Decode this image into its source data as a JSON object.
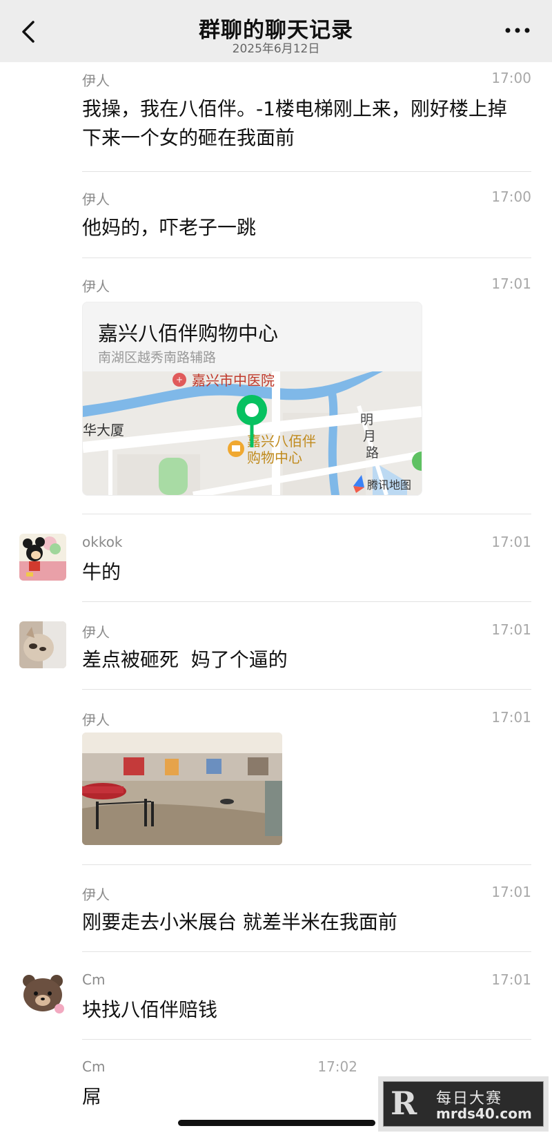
{
  "header": {
    "title": "群聊的聊天记录",
    "subtitle": "2025年6月12日"
  },
  "messages": [
    {
      "name": "伊人",
      "time": "17:00",
      "text": "我操，我在八佰伴。-1楼电梯刚上来，刚好楼上掉下来一个女的砸在我面前"
    },
    {
      "name": "伊人",
      "time": "17:00",
      "text": "他妈的，吓老子一跳"
    },
    {
      "name": "伊人",
      "time": "17:01",
      "location": {
        "title": "嘉兴八佰伴购物中心",
        "address": "南湖区越秀南路辅路",
        "map_labels": {
          "hospital": "嘉兴市中医院",
          "building": "华大厦",
          "poi_line1": "嘉兴八佰伴",
          "poi_line2": "购物中心",
          "road_1": "明",
          "road_2": "月",
          "road_3": "路",
          "provider": "腾讯地图"
        }
      }
    },
    {
      "name": "okkok",
      "time": "17:01",
      "text": "牛的",
      "avatar": "mickey-avatar"
    },
    {
      "name": "伊人",
      "time": "17:01",
      "text": "差点被砸死  妈了个逼的",
      "avatar": "cat-avatar"
    },
    {
      "name": "伊人",
      "time": "17:01",
      "image": "mall-interior-photo"
    },
    {
      "name": "伊人",
      "time": "17:01",
      "text": "刚要走去小米展台 就差半米在我面前"
    },
    {
      "name": "Cm",
      "time": "17:01",
      "text": "块找八佰伴赔钱",
      "avatar": "bear-avatar"
    },
    {
      "name": "Cm",
      "time": "17:02",
      "text": "屌"
    }
  ],
  "watermark": {
    "logo": "R",
    "cn": "每日大赛",
    "url": "mrds40.com"
  },
  "colors": {
    "header_bg": "#ededed",
    "pin_green": "#07c160",
    "map_water": "#7fb8e8",
    "name_gray": "#8a8a8a"
  }
}
